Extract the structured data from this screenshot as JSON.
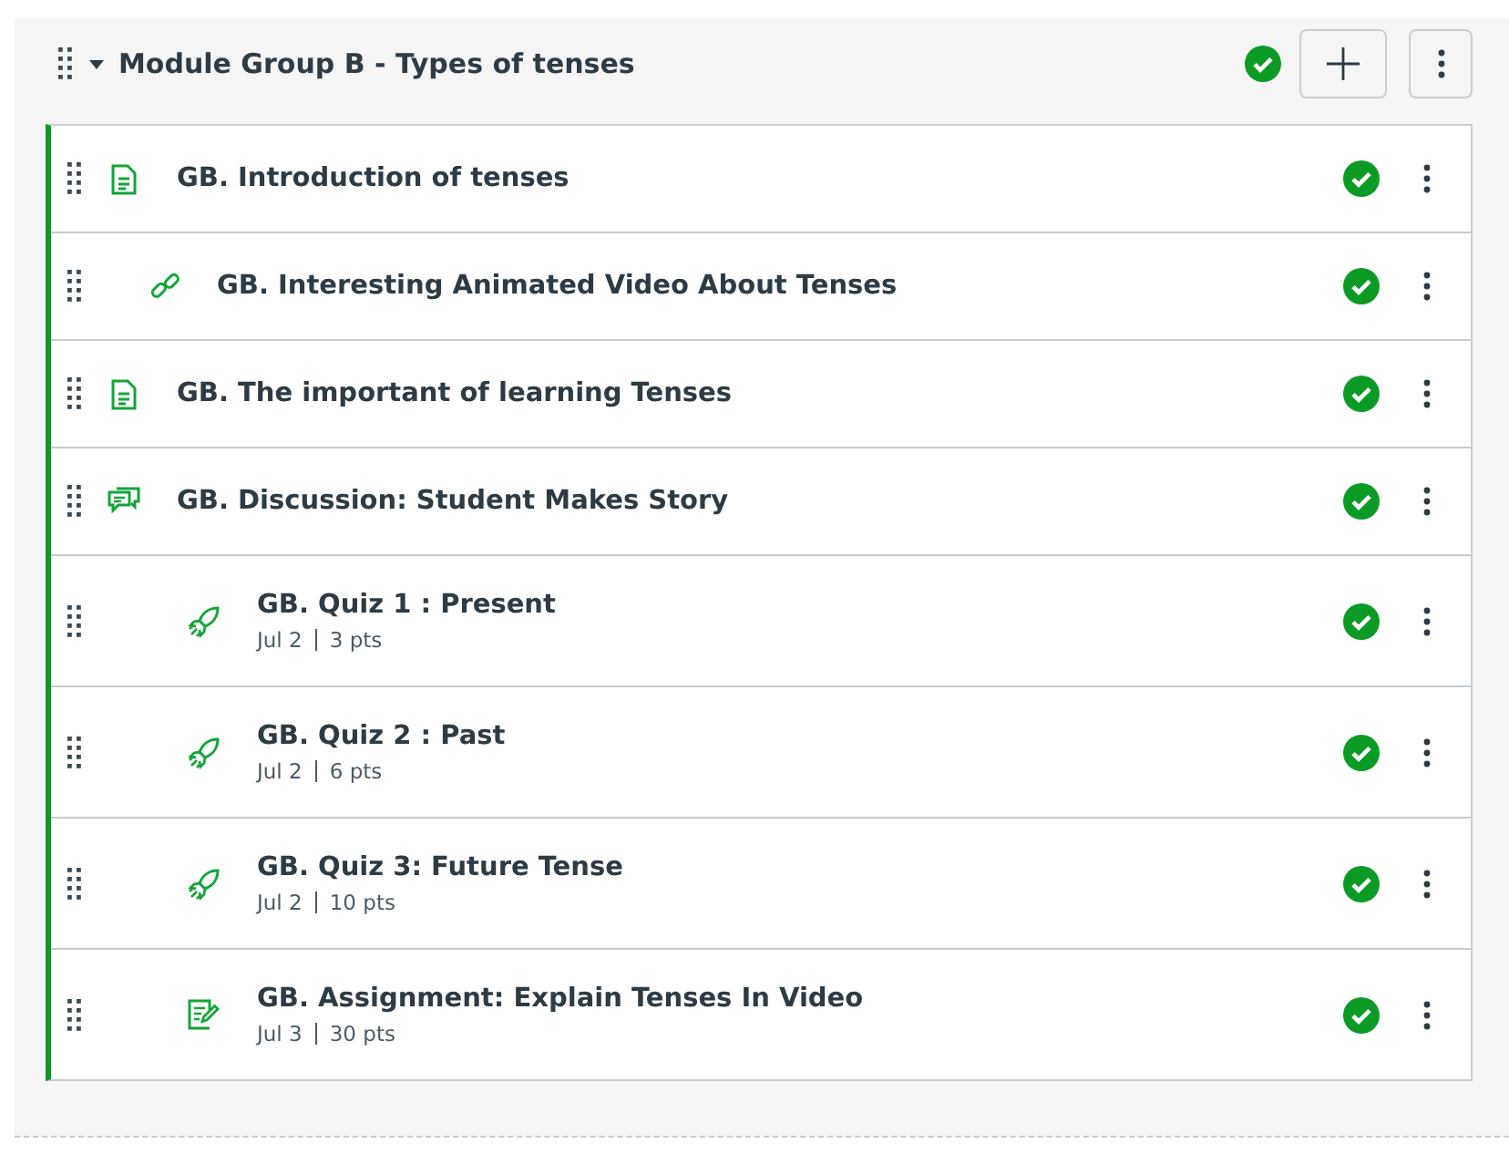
{
  "module": {
    "title": "Module Group B - Types of tenses",
    "expanded": true,
    "published": true,
    "items": [
      {
        "kind": "page",
        "title": "GB. Introduction of tenses",
        "published": true
      },
      {
        "kind": "link",
        "title": "GB. Interesting Animated Video About Tenses",
        "published": true
      },
      {
        "kind": "page",
        "title": "GB. The important of learning Tenses",
        "published": true
      },
      {
        "kind": "discussion",
        "title": "GB. Discussion: Student Makes Story",
        "published": true
      },
      {
        "kind": "quiz",
        "title": "GB. Quiz 1 : Present",
        "date": "Jul 2",
        "points": "3 pts",
        "published": true
      },
      {
        "kind": "quiz",
        "title": "GB. Quiz 2 : Past",
        "date": "Jul 2",
        "points": "6 pts",
        "published": true
      },
      {
        "kind": "quiz",
        "title": "GB. Quiz 3: Future Tense",
        "date": "Jul 2",
        "points": "10 pts",
        "published": true
      },
      {
        "kind": "assignment",
        "title": "GB. Assignment: Explain Tenses In Video",
        "date": "Jul 3",
        "points": "30 pts",
        "published": true
      }
    ]
  }
}
